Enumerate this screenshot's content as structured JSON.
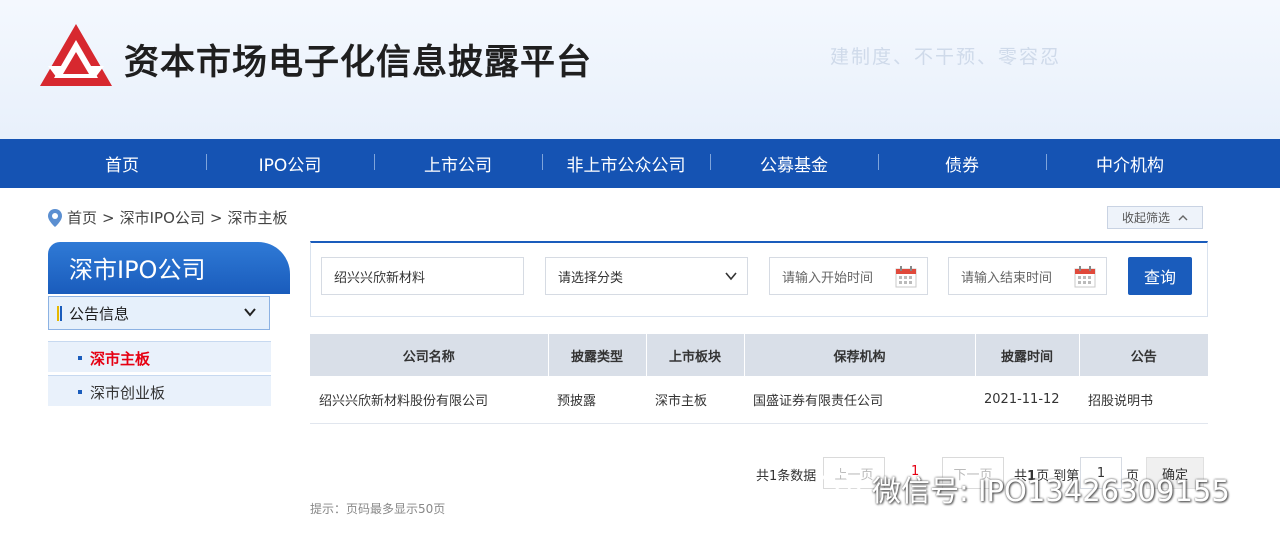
{
  "header": {
    "title": "资本市场电子化信息披露平台",
    "slogan": "建制度、不干预、零容忍"
  },
  "nav": {
    "items": [
      "首页",
      "IPO公司",
      "上市公司",
      "非上市公众公司",
      "公募基金",
      "债券",
      "中介机构"
    ]
  },
  "breadcrumb": {
    "items": [
      "首页",
      "深市IPO公司",
      "深市主板"
    ],
    "separator": ">"
  },
  "collapse_filter_label": "收起筛选",
  "sidebar": {
    "title": "深市IPO公司",
    "section": "公告信息",
    "items": [
      {
        "label": "深市主板",
        "active": true
      },
      {
        "label": "深市创业板",
        "active": false
      }
    ]
  },
  "filters": {
    "company_value": "绍兴兴欣新材料",
    "category_placeholder": "请选择分类",
    "start_placeholder": "请输入开始时间",
    "end_placeholder": "请输入结束时间",
    "query_label": "查询"
  },
  "table": {
    "headers": [
      "公司名称",
      "披露类型",
      "上市板块",
      "保荐机构",
      "披露时间",
      "公告"
    ],
    "rows": [
      [
        "绍兴兴欣新材料股份有限公司",
        "预披露",
        "深市主板",
        "国盛证券有限责任公司",
        "2021-11-12",
        "招股说明书"
      ]
    ]
  },
  "pagination": {
    "total_prefix": "共",
    "total_count": "1",
    "total_suffix": "条数据",
    "prev_label": "上一页",
    "current_page": "1",
    "next_label": "下一页",
    "pages_prefix": "共",
    "pages_count": "1",
    "pages_suffix": "页",
    "goto_label": "到第",
    "goto_value": "1",
    "goto_suffix": "页",
    "confirm_label": "确定"
  },
  "hint": "提示：页码最多显示50页",
  "watermark": "微信号: IPO13426309155",
  "colors": {
    "brand_blue": "#1553b3",
    "accent_red": "#e60012",
    "logo_red": "#d7282f"
  }
}
